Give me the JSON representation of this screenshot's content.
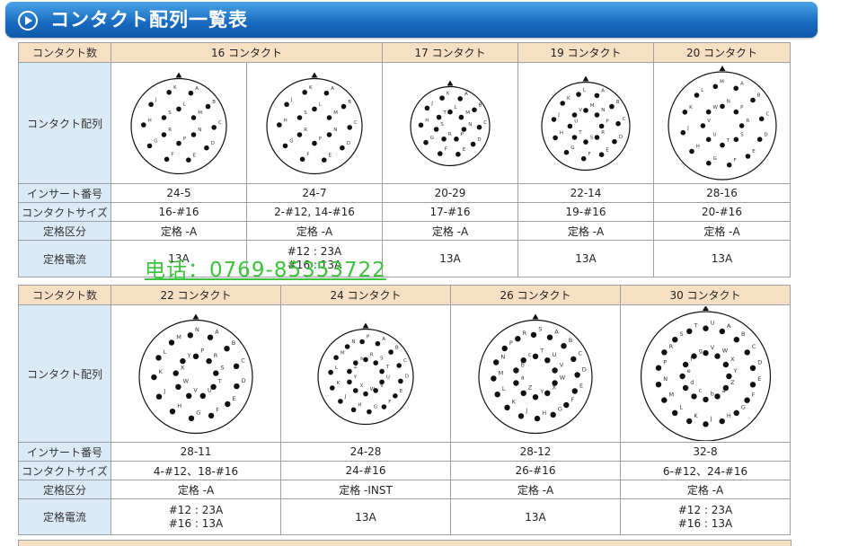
{
  "page": {
    "title": "コンタクト配列一覧表",
    "phone_watermark": "电话：0769-85353722"
  },
  "labels": {
    "contact_count": "コンタクト数",
    "contact_layout": "コンタクト配列",
    "insert_number": "インサート番号",
    "contact_size": "コンタクトサイズ",
    "rating_class": "定格区分",
    "rated_current": "定格電流"
  },
  "table1": {
    "groups": [
      "16 コンタクト",
      "17 コンタクト",
      "19 コンタクト",
      "20 コンタクト"
    ],
    "columns": [
      {
        "insert": "24-5",
        "size": "16-#16",
        "rating": "定格 -A",
        "current": "13A",
        "pins": [
          "A",
          "B",
          "C",
          "D",
          "E",
          "F",
          "G",
          "H",
          "J",
          "K",
          "L",
          "M",
          "N",
          "P",
          "R",
          "S"
        ]
      },
      {
        "insert": "24-7",
        "size": "2-#12, 14-#16",
        "rating": "定格 -A",
        "current_lines": [
          "#12 : 23A",
          "#16 : 13A"
        ],
        "pins": [
          "A",
          "B",
          "C",
          "D",
          "E",
          "F",
          "G",
          "H",
          "J",
          "K",
          "L",
          "M",
          "N",
          "P",
          "R",
          "S"
        ]
      },
      {
        "insert": "20-29",
        "size": "17-#16",
        "rating": "定格 -A",
        "current": "13A",
        "pins": [
          "A",
          "B",
          "C",
          "D",
          "E",
          "F",
          "G",
          "H",
          "J",
          "K",
          "L",
          "M",
          "N",
          "P",
          "R",
          "S",
          "T"
        ]
      },
      {
        "insert": "22-14",
        "size": "19-#16",
        "rating": "定格 -A",
        "current": "13A",
        "pins": [
          "A",
          "B",
          "C",
          "D",
          "E",
          "F",
          "G",
          "H",
          "J",
          "K",
          "L",
          "M",
          "N",
          "P",
          "R",
          "S",
          "T",
          "U",
          "V"
        ]
      },
      {
        "insert": "28-16",
        "size": "20-#16",
        "rating": "定格 -A",
        "current": "13A",
        "pins": [
          "A",
          "B",
          "C",
          "D",
          "E",
          "F",
          "G",
          "H",
          "J",
          "K",
          "L",
          "M",
          "N",
          "P",
          "R",
          "S",
          "T",
          "U",
          "V",
          "W"
        ]
      }
    ]
  },
  "table2": {
    "groups": [
      "22 コンタクト",
      "24 コンタクト",
      "26 コンタクト",
      "30 コンタクト"
    ],
    "columns": [
      {
        "insert": "28-11",
        "size": "4-#12、18-#16",
        "rating": "定格 -A",
        "current_lines": [
          "#12 : 23A",
          "#16 : 13A"
        ],
        "pins": [
          "A",
          "B",
          "C",
          "D",
          "E",
          "F",
          "G",
          "H",
          "J",
          "K",
          "L",
          "M",
          "N",
          "P",
          "R",
          "S",
          "T",
          "U",
          "V",
          "W",
          "X",
          "Y"
        ]
      },
      {
        "insert": "24-28",
        "size": "24-#16",
        "rating": "定格 -INST",
        "current": "13A",
        "pins": [
          "A",
          "B",
          "C",
          "D",
          "E",
          "F",
          "G",
          "H",
          "J",
          "K",
          "L",
          "M",
          "N",
          "P",
          "R",
          "S",
          "T",
          "U",
          "V",
          "W",
          "X",
          "Y",
          "Z",
          "a"
        ]
      },
      {
        "insert": "28-12",
        "size": "26-#16",
        "rating": "定格 -A",
        "current": "13A",
        "pins": [
          "A",
          "B",
          "C",
          "D",
          "E",
          "F",
          "G",
          "H",
          "J",
          "K",
          "L",
          "M",
          "N",
          "P",
          "R",
          "S",
          "T",
          "U",
          "V",
          "W",
          "X",
          "Y",
          "Z",
          "a",
          "b",
          "c"
        ]
      },
      {
        "insert": "32-8",
        "size": "6-#12、24-#16",
        "rating": "定格 -A",
        "current_lines": [
          "#12 : 23A",
          "#16 : 13A"
        ],
        "pins": [
          "A",
          "B",
          "C",
          "D",
          "E",
          "F",
          "G",
          "H",
          "J",
          "K",
          "L",
          "M",
          "N",
          "P",
          "R",
          "S",
          "T",
          "U",
          "V",
          "W",
          "X",
          "Y",
          "Z",
          "a",
          "b",
          "c",
          "d",
          "e",
          "f",
          "g"
        ]
      }
    ]
  }
}
